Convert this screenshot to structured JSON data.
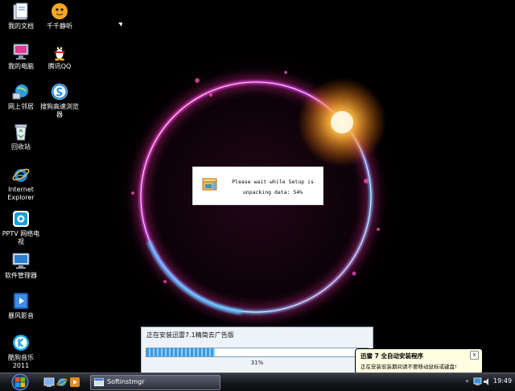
{
  "desktop_icons": [
    {
      "label": "我的文档",
      "icon": "folder-documents-icon"
    },
    {
      "label": "千千静听",
      "icon": "ttplayer-icon"
    },
    {
      "label": "我的电脑",
      "icon": "computer-icon"
    },
    {
      "label": "腾讯QQ",
      "icon": "qq-penguin-icon"
    },
    {
      "label": "网上邻居",
      "icon": "network-icon"
    },
    {
      "label": "搜狗高速浏览器",
      "icon": "sogou-browser-icon"
    },
    {
      "label": "回收站",
      "icon": "recycle-bin-icon"
    },
    {
      "label": "Internet Explorer",
      "icon": "internet-explorer-icon"
    },
    {
      "label": "PPTV 网络电视",
      "icon": "pptv-icon"
    },
    {
      "label": "软件管理器",
      "icon": "software-manager-icon"
    },
    {
      "label": "暴风影音",
      "icon": "baofeng-icon"
    },
    {
      "label": "酷狗音乐 2011",
      "icon": "kugou-icon"
    }
  ],
  "setup_dialog": {
    "line1": "Please wait while Setup is",
    "line2": "unpacking data: 54%",
    "progress_percent": 54
  },
  "install_window": {
    "title": "正在安装迅雷7.1精简去广告版",
    "percent_label": "31%",
    "progress_fraction": 0.31
  },
  "balloon": {
    "title": "迅雷 7 全自动安装程序",
    "text": "正在安装安装期间请不要移动鼠标或键盘!",
    "close_glyph": "x"
  },
  "taskbar": {
    "task_label": "Softinstmgr",
    "tray_arrow": "«",
    "clock": "19:49"
  },
  "colors": {
    "desktop": "#000000",
    "ring_pink": "#ff3fb5",
    "ring_blue": "#59c6ff",
    "ring_orange": "#ffb03a",
    "progress": "#3a9be3",
    "balloon": "#ffffe1"
  }
}
